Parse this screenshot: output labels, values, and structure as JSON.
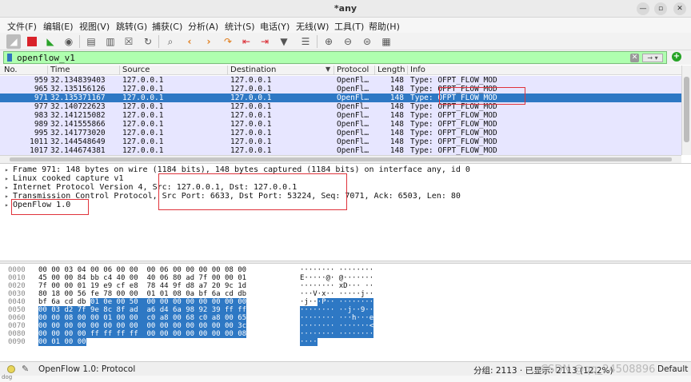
{
  "window": {
    "title": "*any"
  },
  "menu": [
    "文件(F)",
    "编辑(E)",
    "视图(V)",
    "跳转(G)",
    "捕获(C)",
    "分析(A)",
    "统计(S)",
    "电话(Y)",
    "无线(W)",
    "工具(T)",
    "帮助(H)"
  ],
  "filter": {
    "value": "openflow_v1"
  },
  "columns": [
    "No.",
    "Time",
    "Source",
    "Destination",
    "Protocol",
    "Length",
    "Info"
  ],
  "packets": [
    {
      "no": "959",
      "time": "32.134839403",
      "src": "127.0.0.1",
      "dst": "127.0.0.1",
      "proto": "OpenFl…",
      "len": "148",
      "info": "Type: OFPT_FLOW_MOD"
    },
    {
      "no": "965",
      "time": "32.135156126",
      "src": "127.0.0.1",
      "dst": "127.0.0.1",
      "proto": "OpenFl…",
      "len": "148",
      "info": "Type: OFPT_FLOW_MOD"
    },
    {
      "no": "971",
      "time": "32.135371167",
      "src": "127.0.0.1",
      "dst": "127.0.0.1",
      "proto": "OpenFl…",
      "len": "148",
      "info": "Type: OFPT_FLOW_MOD",
      "selected": true
    },
    {
      "no": "977",
      "time": "32.140722623",
      "src": "127.0.0.1",
      "dst": "127.0.0.1",
      "proto": "OpenFl…",
      "len": "148",
      "info": "Type: OFPT_FLOW_MOD"
    },
    {
      "no": "983",
      "time": "32.141215082",
      "src": "127.0.0.1",
      "dst": "127.0.0.1",
      "proto": "OpenFl…",
      "len": "148",
      "info": "Type: OFPT_FLOW_MOD"
    },
    {
      "no": "989",
      "time": "32.141555866",
      "src": "127.0.0.1",
      "dst": "127.0.0.1",
      "proto": "OpenFl…",
      "len": "148",
      "info": "Type: OFPT_FLOW_MOD"
    },
    {
      "no": "995",
      "time": "32.141773020",
      "src": "127.0.0.1",
      "dst": "127.0.0.1",
      "proto": "OpenFl…",
      "len": "148",
      "info": "Type: OFPT_FLOW_MOD"
    },
    {
      "no": "1011",
      "time": "32.144548649",
      "src": "127.0.0.1",
      "dst": "127.0.0.1",
      "proto": "OpenFl…",
      "len": "148",
      "info": "Type: OFPT_FLOW_MOD"
    },
    {
      "no": "1017",
      "time": "32.144674381",
      "src": "127.0.0.1",
      "dst": "127.0.0.1",
      "proto": "OpenFl…",
      "len": "148",
      "info": "Type: OFPT_FLOW_MOD"
    }
  ],
  "details": [
    "Frame 971: 148 bytes on wire (1184 bits), 148 bytes captured (1184 bits) on interface any, id 0",
    "Linux cooked capture v1",
    "Internet Protocol Version 4, Src: 127.0.0.1, Dst: 127.0.0.1",
    "Transmission Control Protocol, Src Port: 6633, Dst Port: 53224, Seq: 7071, Ack: 6503, Len: 80",
    "OpenFlow 1.0"
  ],
  "bytes": [
    {
      "off": "0000",
      "hex": "00 00 03 04 00 06 00 00  00 06 00 00 00 00 08 00",
      "ascii": "········ ········",
      "hl_hex": 0,
      "hl_ascii": 0
    },
    {
      "off": "0010",
      "hex": "45 00 00 84 bb c4 40 00  40 06 80 ad 7f 00 00 01",
      "ascii": "E·····@· @·······",
      "hl_hex": 0,
      "hl_ascii": 0
    },
    {
      "off": "0020",
      "hex": "7f 00 00 01 19 e9 cf e8  78 44 9f d8 a7 20 9c 1d",
      "ascii": "········ xD··· ··",
      "hl_hex": 0,
      "hl_ascii": 0
    },
    {
      "off": "0030",
      "hex": "80 18 00 56 fe 78 00 00  01 01 08 0a bf 6a cd db",
      "ascii": "···V·x·· ·····j··",
      "hl_hex": 0,
      "hl_ascii": 0
    },
    {
      "off": "0040",
      "hex": "bf 6a cd db 01 0e 00 50  00 00 00 00 00 00 00 00",
      "ascii": "·j···P·· ········",
      "hl_hex": 12,
      "hl_ascii": 4
    },
    {
      "off": "0050",
      "hex": "00 03 d2 7f 9e 8c 8f ad  a6 d4 6a 98 92 39 ff ff",
      "ascii": "········ ··j··9··",
      "hl_hex": 0,
      "hl_ascii": 0,
      "full": true
    },
    {
      "off": "0060",
      "hex": "00 00 08 00 00 01 00 00  c0 a8 00 68 c0 a8 00 65",
      "ascii": "········ ···h···e",
      "hl_hex": 0,
      "hl_ascii": 0,
      "full": true
    },
    {
      "off": "0070",
      "hex": "00 00 00 00 00 00 00 00  00 00 00 00 00 00 00 3c",
      "ascii": "········ ·······<",
      "hl_hex": 0,
      "hl_ascii": 0,
      "full": true
    },
    {
      "off": "0080",
      "hex": "00 00 00 00 ff ff ff ff  00 00 00 00 00 00 00 08",
      "ascii": "········ ········",
      "hl_hex": 0,
      "hl_ascii": 0,
      "full": true
    },
    {
      "off": "0090",
      "hex": "00 01 00 00",
      "ascii": "····",
      "hl_hex": 0,
      "hl_ascii": 0,
      "full": true
    }
  ],
  "status": {
    "left": "OpenFlow 1.0: Protocol",
    "right": "分组: 2113 · 已显示: 2113 (12.2%)",
    "profile": "Default",
    "bottom": "dog"
  },
  "watermark": "CSDN @qq_24508896"
}
